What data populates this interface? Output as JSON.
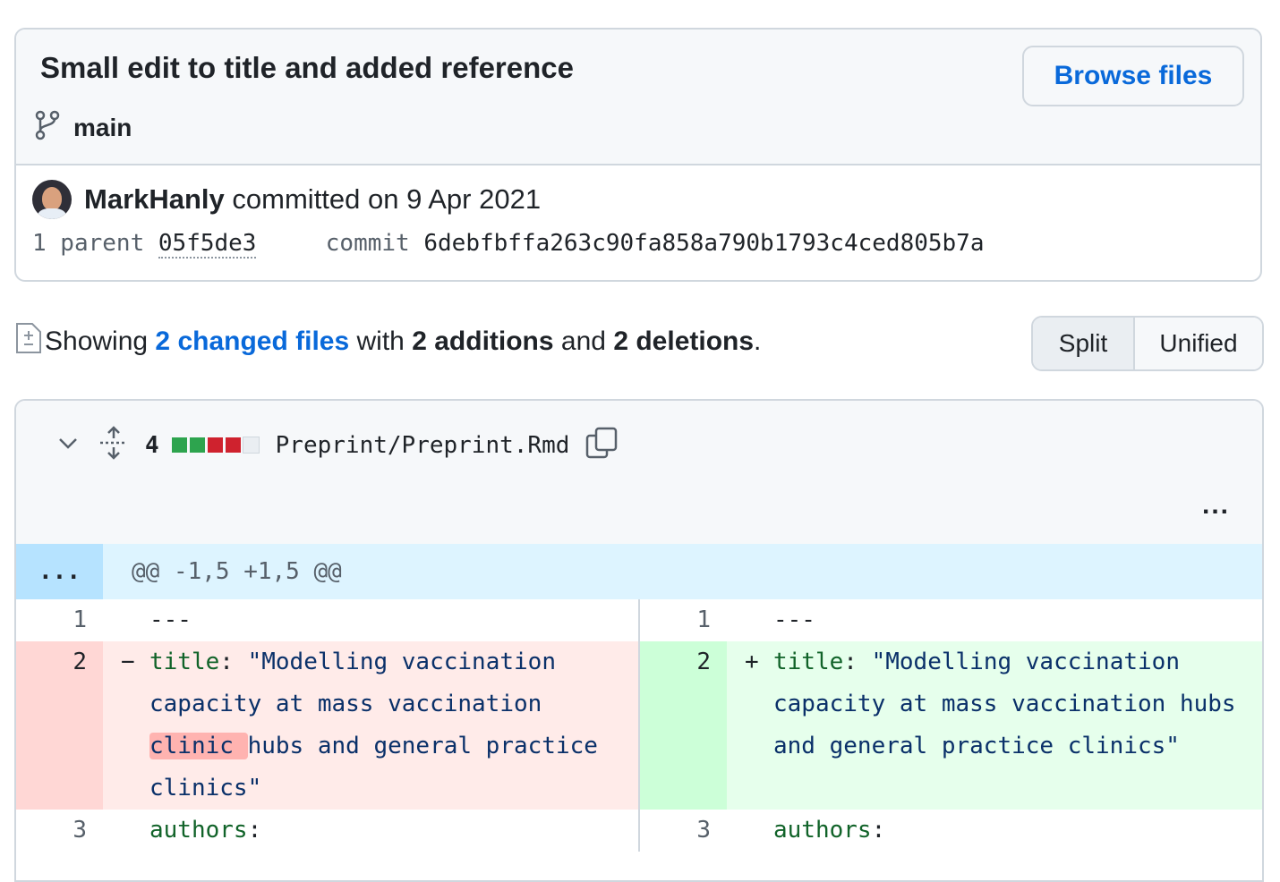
{
  "commit": {
    "title": "Small edit to title and added reference",
    "browse_label": "Browse files",
    "branch": "main",
    "author": "MarkHanly",
    "committed_text": "committed on 9 Apr 2021",
    "parent_label": "1 parent",
    "parent_sha": "05f5de3",
    "commit_label": "commit",
    "commit_sha": "6debfbffa263c90fa858a790b1793c4ced805b7a"
  },
  "summary": {
    "showing": "Showing",
    "changed_files": "2 changed files",
    "with": "with",
    "additions": "2 additions",
    "and": "and",
    "deletions": "2 deletions",
    "period": "."
  },
  "view_toggle": {
    "split": "Split",
    "unified": "Unified",
    "selected": "Split"
  },
  "file": {
    "diff_count": "4",
    "diffstat": [
      "added",
      "added",
      "deleted",
      "deleted",
      "neutral"
    ],
    "name": "Preprint/Preprint.Rmd",
    "more": "...",
    "hunk_expand": "...",
    "hunk_header": "@@ -1,5 +1,5 @@",
    "left": {
      "line1_no": "1",
      "line1": "---",
      "line2_no": "2",
      "line2_sign": "−",
      "line2_key": "title",
      "line2_colon": ": ",
      "line2_a": "\"Modelling vaccination capacity at mass vaccination ",
      "line2_hl": "clinic ",
      "line2_b": "hubs and general practice clinics\"",
      "line3_no": "3",
      "line3_key": "authors",
      "line3_colon": ":"
    },
    "right": {
      "line1_no": "1",
      "line1": "---",
      "line2_no": "2",
      "line2_sign": "+",
      "line2_key": "title",
      "line2_colon": ": ",
      "line2_a": "\"Modelling vaccination capacity at mass vaccination hubs and general practice clinics\"",
      "line3_no": "3",
      "line3_key": "authors",
      "line3_colon": ":"
    }
  },
  "colors": {
    "added": "#2da44e",
    "deleted": "#cf222e",
    "neutral": "#eaeef2",
    "link": "#0969da"
  }
}
